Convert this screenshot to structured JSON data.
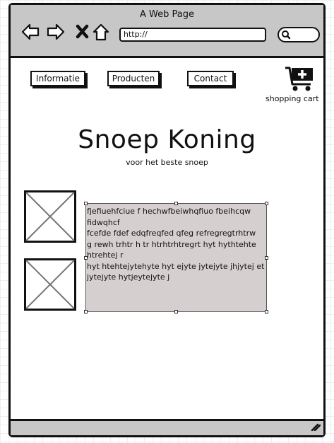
{
  "window": {
    "title": "A Web Page"
  },
  "toolbar": {
    "back_icon": "arrow-left-icon",
    "forward_icon": "arrow-right-icon",
    "stop_icon": "close-icon",
    "home_icon": "home-icon",
    "url": "http://",
    "search_icon": "search-icon"
  },
  "nav": {
    "items": [
      {
        "label": "Informatie"
      },
      {
        "label": "Producten"
      },
      {
        "label": "Contact"
      }
    ]
  },
  "cart": {
    "icon": "shopping-cart-icon",
    "label": "shopping cart"
  },
  "hero": {
    "title": "Snoep Koning",
    "subtitle": "voor het beste snoep"
  },
  "content": {
    "lines": [
      "fjefiuehfciue f hechwfbeiwhqfiuo  fbeihcqw fidwqhcf",
      "fcefde fdef edqfreqfed qfeg refregregtrhtrw",
      "g rewh trhtr h tr  htrhtrhtregrt hyt hythtehte htrehtej r",
      " hyt htehtejytehyte hyt ejyte jytejyte jhjytej et",
      " jytejyte hytjeytejyte j"
    ]
  },
  "colors": {
    "chrome": "#c7c7c7",
    "text_area_bg": "#d6cfcf",
    "outline": "#111111"
  }
}
